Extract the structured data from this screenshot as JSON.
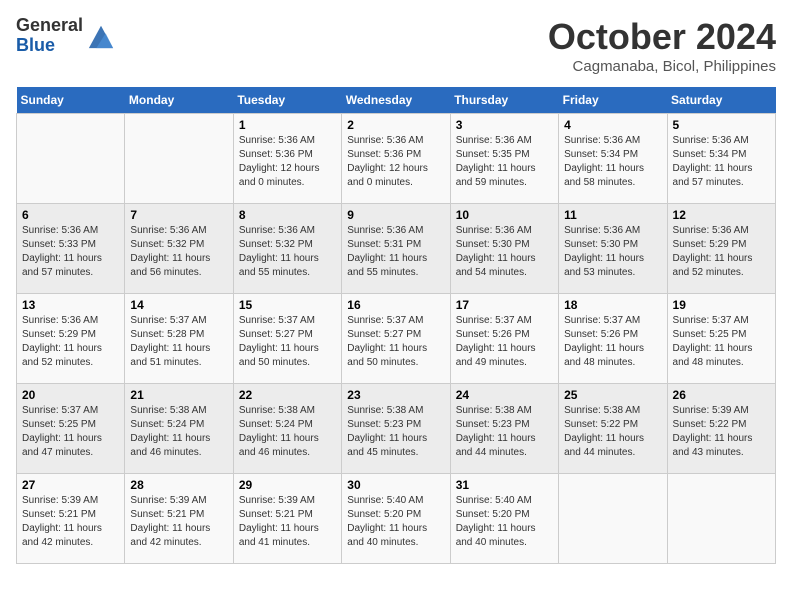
{
  "header": {
    "logo_general": "General",
    "logo_blue": "Blue",
    "month": "October 2024",
    "location": "Cagmanaba, Bicol, Philippines"
  },
  "weekdays": [
    "Sunday",
    "Monday",
    "Tuesday",
    "Wednesday",
    "Thursday",
    "Friday",
    "Saturday"
  ],
  "weeks": [
    [
      {
        "day": "",
        "detail": ""
      },
      {
        "day": "",
        "detail": ""
      },
      {
        "day": "1",
        "detail": "Sunrise: 5:36 AM\nSunset: 5:36 PM\nDaylight: 12 hours\nand 0 minutes."
      },
      {
        "day": "2",
        "detail": "Sunrise: 5:36 AM\nSunset: 5:36 PM\nDaylight: 12 hours\nand 0 minutes."
      },
      {
        "day": "3",
        "detail": "Sunrise: 5:36 AM\nSunset: 5:35 PM\nDaylight: 11 hours\nand 59 minutes."
      },
      {
        "day": "4",
        "detail": "Sunrise: 5:36 AM\nSunset: 5:34 PM\nDaylight: 11 hours\nand 58 minutes."
      },
      {
        "day": "5",
        "detail": "Sunrise: 5:36 AM\nSunset: 5:34 PM\nDaylight: 11 hours\nand 57 minutes."
      }
    ],
    [
      {
        "day": "6",
        "detail": "Sunrise: 5:36 AM\nSunset: 5:33 PM\nDaylight: 11 hours\nand 57 minutes."
      },
      {
        "day": "7",
        "detail": "Sunrise: 5:36 AM\nSunset: 5:32 PM\nDaylight: 11 hours\nand 56 minutes."
      },
      {
        "day": "8",
        "detail": "Sunrise: 5:36 AM\nSunset: 5:32 PM\nDaylight: 11 hours\nand 55 minutes."
      },
      {
        "day": "9",
        "detail": "Sunrise: 5:36 AM\nSunset: 5:31 PM\nDaylight: 11 hours\nand 55 minutes."
      },
      {
        "day": "10",
        "detail": "Sunrise: 5:36 AM\nSunset: 5:30 PM\nDaylight: 11 hours\nand 54 minutes."
      },
      {
        "day": "11",
        "detail": "Sunrise: 5:36 AM\nSunset: 5:30 PM\nDaylight: 11 hours\nand 53 minutes."
      },
      {
        "day": "12",
        "detail": "Sunrise: 5:36 AM\nSunset: 5:29 PM\nDaylight: 11 hours\nand 52 minutes."
      }
    ],
    [
      {
        "day": "13",
        "detail": "Sunrise: 5:36 AM\nSunset: 5:29 PM\nDaylight: 11 hours\nand 52 minutes."
      },
      {
        "day": "14",
        "detail": "Sunrise: 5:37 AM\nSunset: 5:28 PM\nDaylight: 11 hours\nand 51 minutes."
      },
      {
        "day": "15",
        "detail": "Sunrise: 5:37 AM\nSunset: 5:27 PM\nDaylight: 11 hours\nand 50 minutes."
      },
      {
        "day": "16",
        "detail": "Sunrise: 5:37 AM\nSunset: 5:27 PM\nDaylight: 11 hours\nand 50 minutes."
      },
      {
        "day": "17",
        "detail": "Sunrise: 5:37 AM\nSunset: 5:26 PM\nDaylight: 11 hours\nand 49 minutes."
      },
      {
        "day": "18",
        "detail": "Sunrise: 5:37 AM\nSunset: 5:26 PM\nDaylight: 11 hours\nand 48 minutes."
      },
      {
        "day": "19",
        "detail": "Sunrise: 5:37 AM\nSunset: 5:25 PM\nDaylight: 11 hours\nand 48 minutes."
      }
    ],
    [
      {
        "day": "20",
        "detail": "Sunrise: 5:37 AM\nSunset: 5:25 PM\nDaylight: 11 hours\nand 47 minutes."
      },
      {
        "day": "21",
        "detail": "Sunrise: 5:38 AM\nSunset: 5:24 PM\nDaylight: 11 hours\nand 46 minutes."
      },
      {
        "day": "22",
        "detail": "Sunrise: 5:38 AM\nSunset: 5:24 PM\nDaylight: 11 hours\nand 46 minutes."
      },
      {
        "day": "23",
        "detail": "Sunrise: 5:38 AM\nSunset: 5:23 PM\nDaylight: 11 hours\nand 45 minutes."
      },
      {
        "day": "24",
        "detail": "Sunrise: 5:38 AM\nSunset: 5:23 PM\nDaylight: 11 hours\nand 44 minutes."
      },
      {
        "day": "25",
        "detail": "Sunrise: 5:38 AM\nSunset: 5:22 PM\nDaylight: 11 hours\nand 44 minutes."
      },
      {
        "day": "26",
        "detail": "Sunrise: 5:39 AM\nSunset: 5:22 PM\nDaylight: 11 hours\nand 43 minutes."
      }
    ],
    [
      {
        "day": "27",
        "detail": "Sunrise: 5:39 AM\nSunset: 5:21 PM\nDaylight: 11 hours\nand 42 minutes."
      },
      {
        "day": "28",
        "detail": "Sunrise: 5:39 AM\nSunset: 5:21 PM\nDaylight: 11 hours\nand 42 minutes."
      },
      {
        "day": "29",
        "detail": "Sunrise: 5:39 AM\nSunset: 5:21 PM\nDaylight: 11 hours\nand 41 minutes."
      },
      {
        "day": "30",
        "detail": "Sunrise: 5:40 AM\nSunset: 5:20 PM\nDaylight: 11 hours\nand 40 minutes."
      },
      {
        "day": "31",
        "detail": "Sunrise: 5:40 AM\nSunset: 5:20 PM\nDaylight: 11 hours\nand 40 minutes."
      },
      {
        "day": "",
        "detail": ""
      },
      {
        "day": "",
        "detail": ""
      }
    ]
  ]
}
